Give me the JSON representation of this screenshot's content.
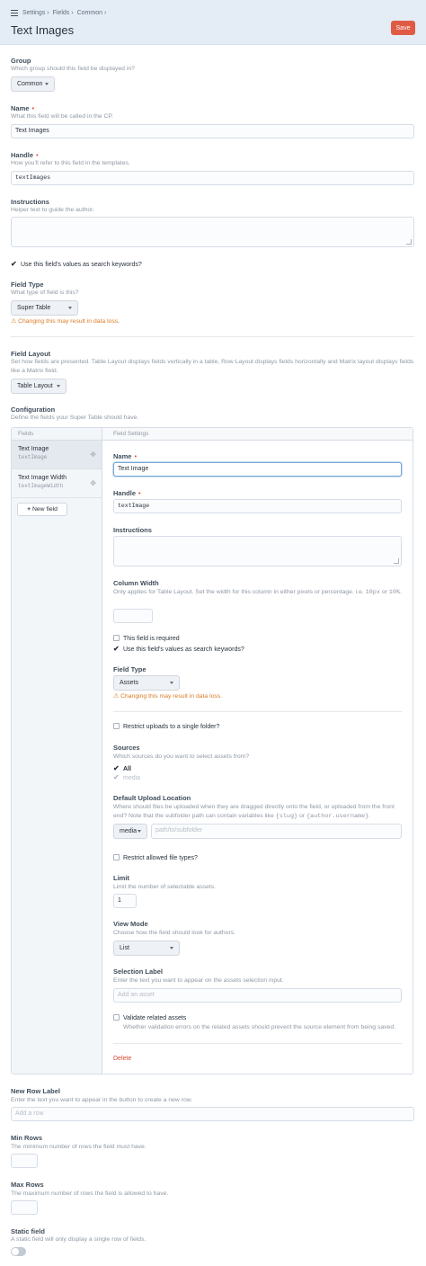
{
  "header": {
    "breadcrumbs": [
      "Settings",
      "Fields",
      "Common"
    ],
    "title": "Text Images",
    "save_label": "Save"
  },
  "form": {
    "group": {
      "label": "Group",
      "instructions": "Which group should this field be displayed in?",
      "value": "Common"
    },
    "name": {
      "label": "Name",
      "instructions": "What this field will be called in the CP.",
      "value": "Text Images"
    },
    "handle": {
      "label": "Handle",
      "instructions": "How you'll refer to this field in the templates.",
      "value": "textImages"
    },
    "instructions": {
      "label": "Instructions",
      "instructions": "Helper text to guide the author."
    },
    "search_keywords": {
      "label": "Use this field's values as search keywords?",
      "checked": true
    },
    "field_type": {
      "label": "Field Type",
      "instructions": "What type of field is this?",
      "value": "Super Table",
      "warning": "Changing this may result in data loss."
    },
    "field_layout": {
      "label": "Field Layout",
      "instructions": "Set how fields are presented. Table Layout displays fields vertically in a table, Row Layout displays fields horizontally and Matrix layout displays fields like a Matrix field.",
      "value": "Table Layout"
    },
    "configuration": {
      "label": "Configuration",
      "instructions": "Define the fields your Super Table should have."
    }
  },
  "config": {
    "fields_head": "Fields",
    "settings_head": "Field Settings",
    "fields": [
      {
        "name": "Text Image",
        "handle": "textImage",
        "selected": true
      },
      {
        "name": "Text Image Width",
        "handle": "textImageWidth",
        "selected": false
      }
    ],
    "new_field_label": "New field",
    "settings": {
      "name_label": "Name",
      "name_value": "Text Image",
      "handle_label": "Handle",
      "handle_value": "textImage",
      "instructions_label": "Instructions",
      "column_width_label": "Column Width",
      "column_width_instructions_a": "Only applies for Table Layout. Set the width for this column in either pixels or percentage. i.e.",
      "column_width_code1": "10px",
      "column_width_or": "or",
      "column_width_code2": "10%",
      "required_label": "This field is required",
      "search_label": "Use this field's values as search keywords?",
      "type_label": "Field Type",
      "type_value": "Assets",
      "type_warning": "Changing this may result in data loss.",
      "restrict_folder_label": "Restrict uploads to a single folder?",
      "sources_label": "Sources",
      "sources_instructions": "Which sources do you want to select assets from?",
      "sources_all": "All",
      "sources_media": "media",
      "upload_location_label": "Default Upload Location",
      "upload_location_instructions_a": "Where should files be uploaded when they are dragged directly onto the field, or uploaded from the front end? Note that the subfolder path can contain variables like",
      "upload_code1": "{slug}",
      "upload_or": "or",
      "upload_code2": "{author.username}",
      "upload_source": "media",
      "upload_path_placeholder": "path/to/subfolder",
      "restrict_types_label": "Restrict allowed file types?",
      "limit_label": "Limit",
      "limit_instructions": "Limit the number of selectable assets.",
      "limit_value": "1",
      "view_mode_label": "View Mode",
      "view_mode_instructions": "Choose how the field should look for authors.",
      "view_mode_value": "List",
      "selection_label_label": "Selection Label",
      "selection_label_instructions": "Enter the text you want to appear on the assets selection input.",
      "selection_label_placeholder": "Add an asset",
      "validate_label": "Validate related assets",
      "validate_instructions": "Whether validation errors on the related assets should prevent the source element from being saved.",
      "delete_label": "Delete"
    }
  },
  "bottom": {
    "new_row_label": {
      "label": "New Row Label",
      "instructions": "Enter the text you want to appear in the button to create a new row.",
      "placeholder": "Add a row"
    },
    "min_rows": {
      "label": "Min Rows",
      "instructions": "The minimum number of rows the field must have."
    },
    "max_rows": {
      "label": "Max Rows",
      "instructions": "The maximum number of rows the field is allowed to have."
    },
    "static_field": {
      "label": "Static field",
      "instructions": "A static field will only display a single row of fields.",
      "on": false
    }
  },
  "colors": {
    "accent": "#e05b44",
    "warning": "#d97a25",
    "header_bg": "#e4edf6"
  }
}
